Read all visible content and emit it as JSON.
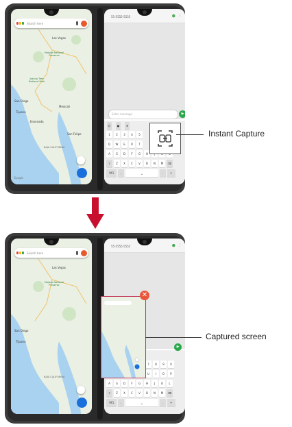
{
  "map": {
    "search_placeholder": "Search here",
    "cities": [
      "Las Vegas",
      "San Diego",
      "Tijuana",
      "Ensenada",
      "San Felipe",
      "Mexicali"
    ],
    "parks": [
      "Mojave National Preserve",
      "Joshua Tree National Park"
    ],
    "region": "BAJA CALIFORNIA",
    "google": "Google"
  },
  "messages": {
    "number": "55-5555-5555",
    "compose_placeholder": "Enter message",
    "keyboard_rows": [
      [
        "1",
        "2",
        "3",
        "4",
        "5",
        "6",
        "7",
        "8",
        "9",
        "0"
      ],
      [
        "Q",
        "W",
        "E",
        "R",
        "T",
        "Y",
        "U",
        "I",
        "O",
        "P"
      ],
      [
        "A",
        "S",
        "D",
        "F",
        "G",
        "H",
        "J",
        "K",
        "L"
      ],
      [
        "Z",
        "X",
        "C",
        "V",
        "B",
        "N",
        "M"
      ]
    ],
    "sym_key": "!#1"
  },
  "callouts": {
    "instant_capture": "Instant Capture",
    "captured_screen": "Captured screen"
  },
  "icons": {
    "capture": "instant-capture-icon",
    "close": "close-icon",
    "arrow": "arrow-down-icon",
    "send": "send-icon"
  },
  "colors": {
    "arrow": "#c8102e",
    "close": "#e8573a",
    "send": "#2aa84a",
    "map_bg": "#eaf0e4",
    "sea": "#a9d2f0"
  }
}
